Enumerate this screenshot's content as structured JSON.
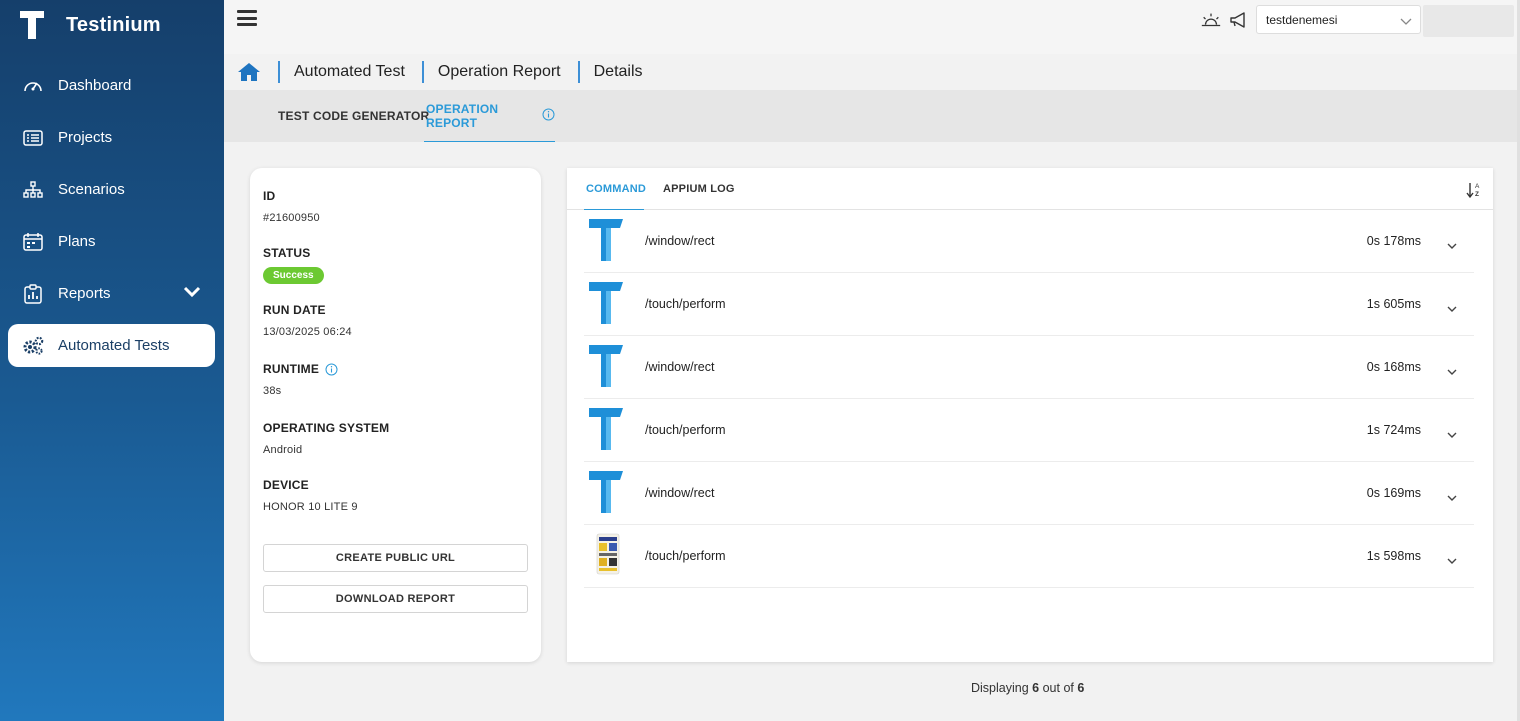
{
  "app": {
    "name": "Testinium"
  },
  "sidebar": {
    "items": [
      {
        "label": "Dashboard",
        "icon": "dashboard-icon",
        "active": false
      },
      {
        "label": "Projects",
        "icon": "projects-icon",
        "active": false
      },
      {
        "label": "Scenarios",
        "icon": "scenarios-icon",
        "active": false
      },
      {
        "label": "Plans",
        "icon": "plans-icon",
        "active": false
      },
      {
        "label": "Reports",
        "icon": "reports-icon",
        "active": false,
        "expandable": true
      },
      {
        "label": "Automated Tests",
        "icon": "gears-icon",
        "active": true
      }
    ]
  },
  "topbar": {
    "project_select": {
      "value": "testdenemesi"
    }
  },
  "breadcrumb": {
    "items": [
      {
        "label": "Automated Test"
      },
      {
        "label": "Operation Report"
      },
      {
        "label": "Details"
      }
    ]
  },
  "subtabs": {
    "items": [
      {
        "label": "TEST CODE GENERATOR",
        "active": false
      },
      {
        "label": "OPERATION REPORT",
        "active": true
      }
    ]
  },
  "details": {
    "id": {
      "label": "ID",
      "value": "#21600950"
    },
    "status": {
      "label": "STATUS",
      "value": "Success"
    },
    "run_date": {
      "label": "RUN DATE",
      "value": "13/03/2025 06:24"
    },
    "runtime": {
      "label": "RUNTIME",
      "value": "38s"
    },
    "os": {
      "label": "OPERATING SYSTEM",
      "value": "Android"
    },
    "device": {
      "label": "DEVICE",
      "value": "HONOR 10 LITE 9"
    },
    "create_url_label": "CREATE PUBLIC URL",
    "download_label": "DOWNLOAD REPORT"
  },
  "panel": {
    "tabs": [
      {
        "label": "COMMAND",
        "active": true
      },
      {
        "label": "APPIUM LOG",
        "active": false
      }
    ],
    "rows": [
      {
        "command": "/window/rect",
        "duration": "0s 178ms",
        "thumb": "testinium-logo"
      },
      {
        "command": "/touch/perform",
        "duration": "1s 605ms",
        "thumb": "testinium-logo"
      },
      {
        "command": "/window/rect",
        "duration": "0s 168ms",
        "thumb": "testinium-logo"
      },
      {
        "command": "/touch/perform",
        "duration": "1s 724ms",
        "thumb": "testinium-logo"
      },
      {
        "command": "/window/rect",
        "duration": "0s 169ms",
        "thumb": "testinium-logo"
      },
      {
        "command": "/touch/perform",
        "duration": "1s 598ms",
        "thumb": "app-screenshot"
      }
    ]
  },
  "footer": {
    "prefix": "Displaying",
    "shown": "6",
    "middle": "out of",
    "total": "6"
  },
  "colors": {
    "accent": "#2b9ad8",
    "success": "#6cc932",
    "sidebar_top": "#153f6b",
    "sidebar_bottom": "#2178bd"
  }
}
